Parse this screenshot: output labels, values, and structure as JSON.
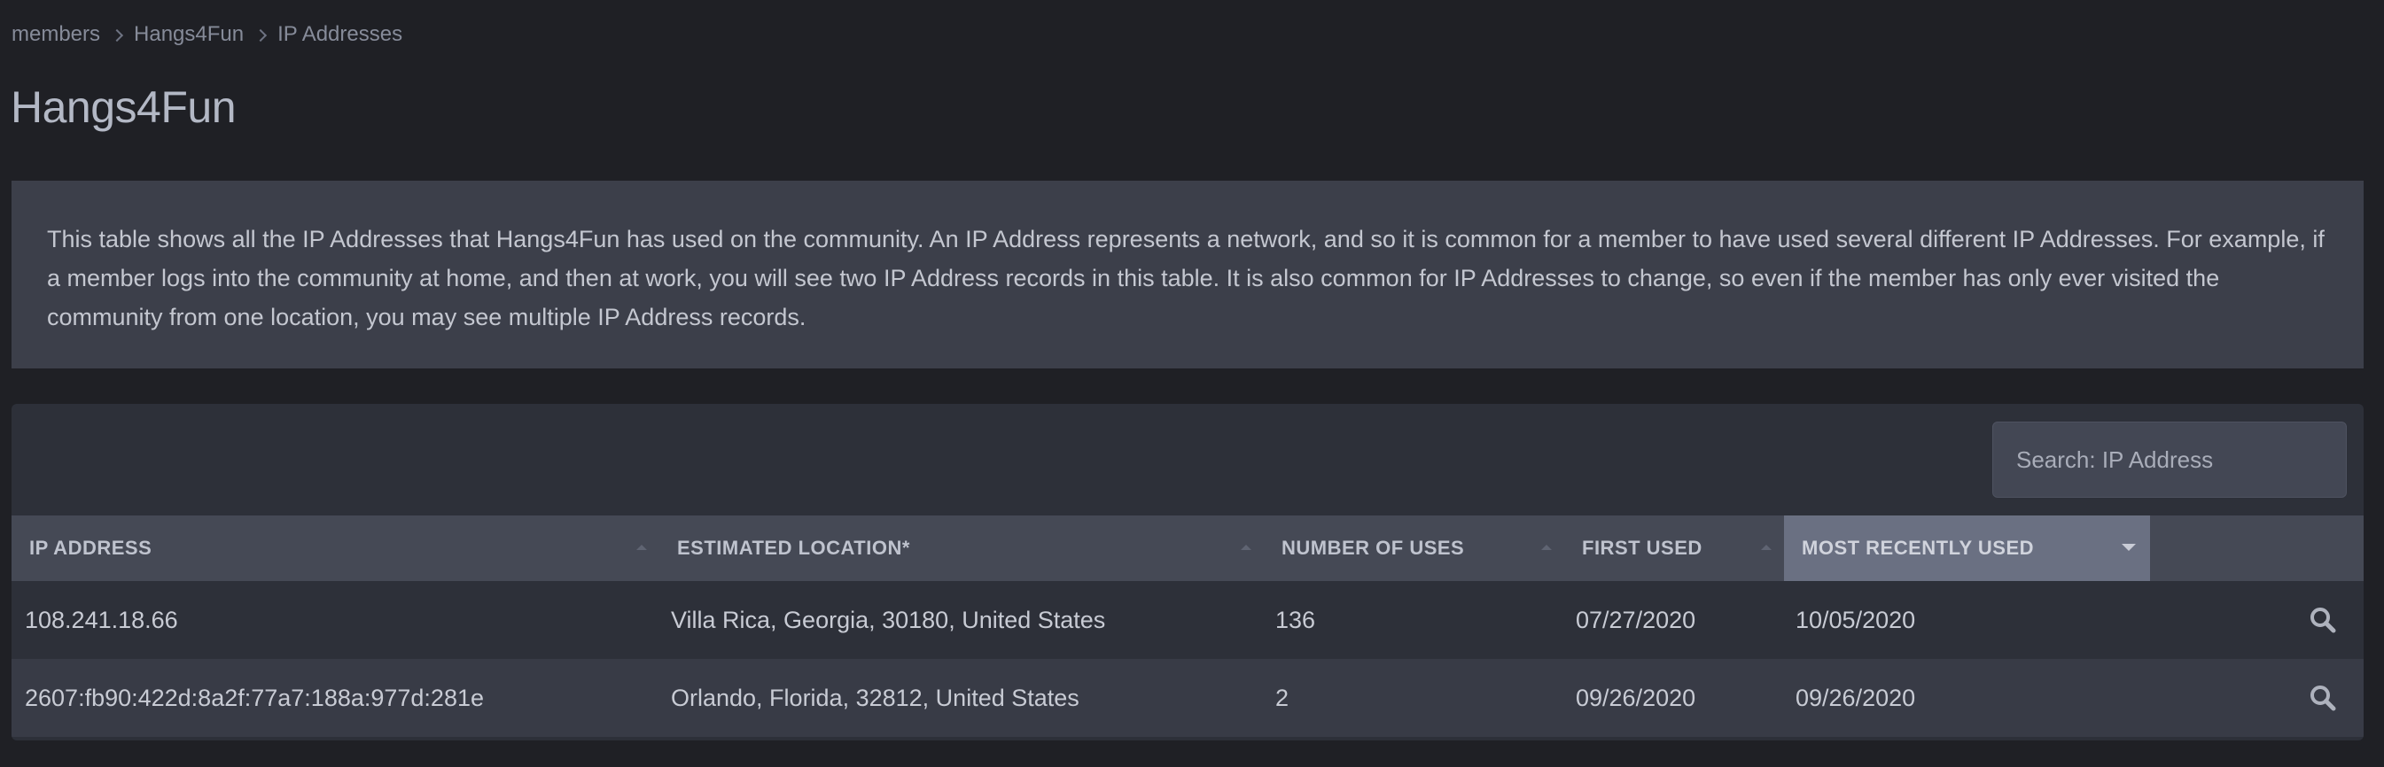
{
  "breadcrumb": {
    "items": [
      "members",
      "Hangs4Fun",
      "IP Addresses"
    ]
  },
  "page": {
    "title": "Hangs4Fun"
  },
  "info": {
    "text": "This table shows all the IP Addresses that Hangs4Fun has used on the community. An IP Address represents a network, and so it is common for a member to have used several different IP Addresses. For example, if a member logs into the community at home, and then at work, you will see two IP Address records in this table. It is also common for IP Addresses to change, so even if the member has only ever visited the community from one location, you may see multiple IP Address records."
  },
  "search": {
    "placeholder": "Search: IP Address"
  },
  "table": {
    "columns": [
      "IP ADDRESS",
      "ESTIMATED LOCATION*",
      "NUMBER OF USES",
      "FIRST USED",
      "MOST RECENTLY USED"
    ],
    "sorted_column": "MOST RECENTLY USED",
    "sort_direction": "descending",
    "rows": [
      {
        "ip": "108.241.18.66",
        "location": "Villa Rica, Georgia, 30180, United States",
        "uses": "136",
        "first_used": "07/27/2020",
        "last_used": "10/05/2020"
      },
      {
        "ip": "2607:fb90:422d:8a2f:77a7:188a:977d:281e",
        "location": "Orlando, Florida, 32812, United States",
        "uses": "2",
        "first_used": "09/26/2020",
        "last_used": "09/26/2020"
      }
    ]
  },
  "icons": {
    "breadcrumb_separator": "chevron-right-icon",
    "row_action": "search-icon"
  },
  "colors": {
    "background": "#1f2025",
    "info_box": "#3c3f4a",
    "table_header": "#454955",
    "active_header": "#6a7082"
  }
}
